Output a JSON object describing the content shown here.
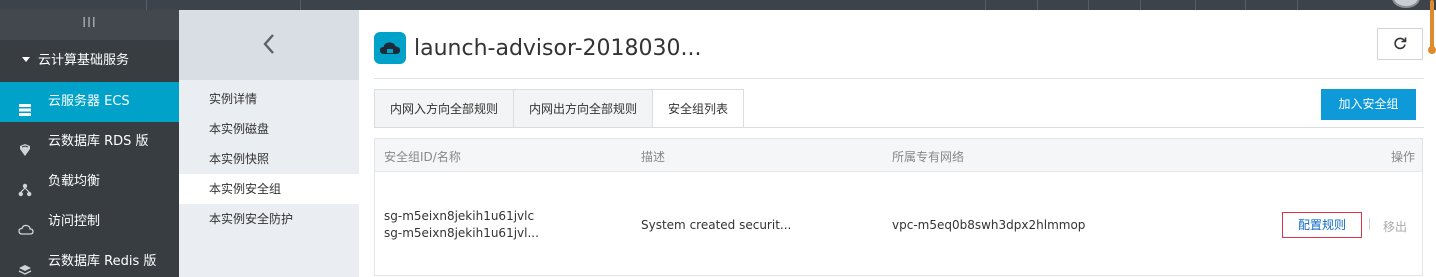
{
  "sidebar": {
    "collapse_glyph": "III",
    "section_title": "云计算基础服务",
    "items": [
      {
        "label": "云服务器 ECS",
        "icon": "server-icon"
      },
      {
        "label": "云数据库 RDS 版",
        "icon": "database-icon"
      },
      {
        "label": "负载均衡",
        "icon": "load-balancer-icon"
      },
      {
        "label": "访问控制",
        "icon": "cloud-access-icon"
      },
      {
        "label": "云数据库 Redis 版",
        "icon": "redis-icon"
      }
    ],
    "active_color": "#00a2ca"
  },
  "subnav": {
    "back_icon": "chevron-left-icon",
    "links": [
      {
        "label": "实例详情"
      },
      {
        "label": "本实例磁盘"
      },
      {
        "label": "本实例快照"
      },
      {
        "label": "本实例安全组"
      },
      {
        "label": "本实例安全防护"
      }
    ]
  },
  "header": {
    "title": "launch-advisor-2018030...",
    "logo_icon": "cloud-server-icon",
    "refresh_icon": "refresh-icon"
  },
  "tabs": [
    {
      "label": "内网入方向全部规则"
    },
    {
      "label": "内网出方向全部规则"
    },
    {
      "label": "安全组列表"
    }
  ],
  "add_button": "加入安全组",
  "table": {
    "headers": [
      "安全组ID/名称",
      "描述",
      "所属专有网络",
      "操作"
    ],
    "rows": [
      {
        "id": "sg-m5eixn8jekih1u61jvlc",
        "name": "sg-m5eixn8jekih1u61jvl...",
        "description": "System created securit...",
        "vpc": "vpc-m5eq0b8swh3dpx2hlmmop",
        "action_primary": "配置规则",
        "action_secondary": "移出"
      }
    ]
  }
}
